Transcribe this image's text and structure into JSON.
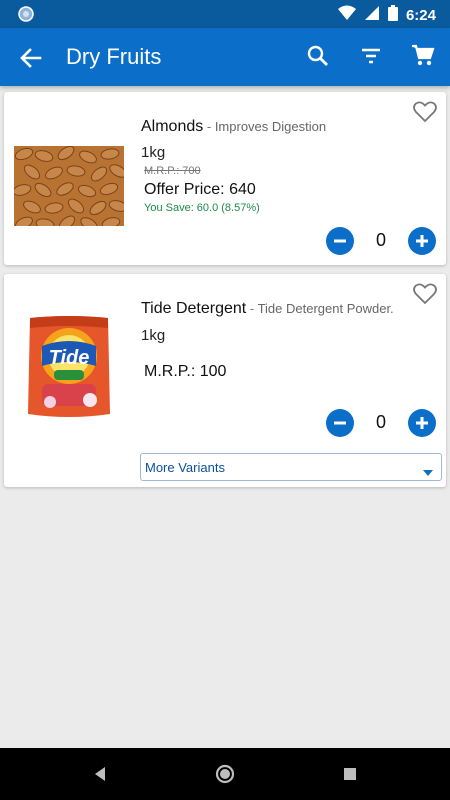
{
  "status_bar": {
    "time": "6:24",
    "icons": [
      "notification-dot-icon",
      "wifi-icon",
      "signal-icon",
      "battery-icon"
    ]
  },
  "app_bar": {
    "title": "Dry Fruits",
    "icons": [
      "back-arrow-icon",
      "search-icon",
      "filter-icon",
      "cart-icon"
    ],
    "color": "#0b6fc9"
  },
  "products": [
    {
      "name": "Almonds",
      "separator": " - ",
      "description": "Improves Digestion",
      "weight": "1kg",
      "mrp": "M.R.P.: 700",
      "offer_price": "Offer Price: 640",
      "you_save": "You Save: 60.0 (8.57%)",
      "quantity": "0",
      "image": "almonds-image"
    },
    {
      "name": "Tide Detergent",
      "separator": " - ",
      "description": "Tide Detergent Powder.",
      "weight": "1kg",
      "mrp": "M.R.P.: 100",
      "quantity": "0",
      "variants_label": "More Variants",
      "image": "tide-detergent-image"
    }
  ],
  "nav_bar": {
    "icons": [
      "nav-back-icon",
      "nav-home-icon",
      "nav-recents-icon"
    ]
  },
  "colors": {
    "accent": "#0b6fc9",
    "save_green": "#1d8a4c",
    "background": "#ebebeb"
  }
}
